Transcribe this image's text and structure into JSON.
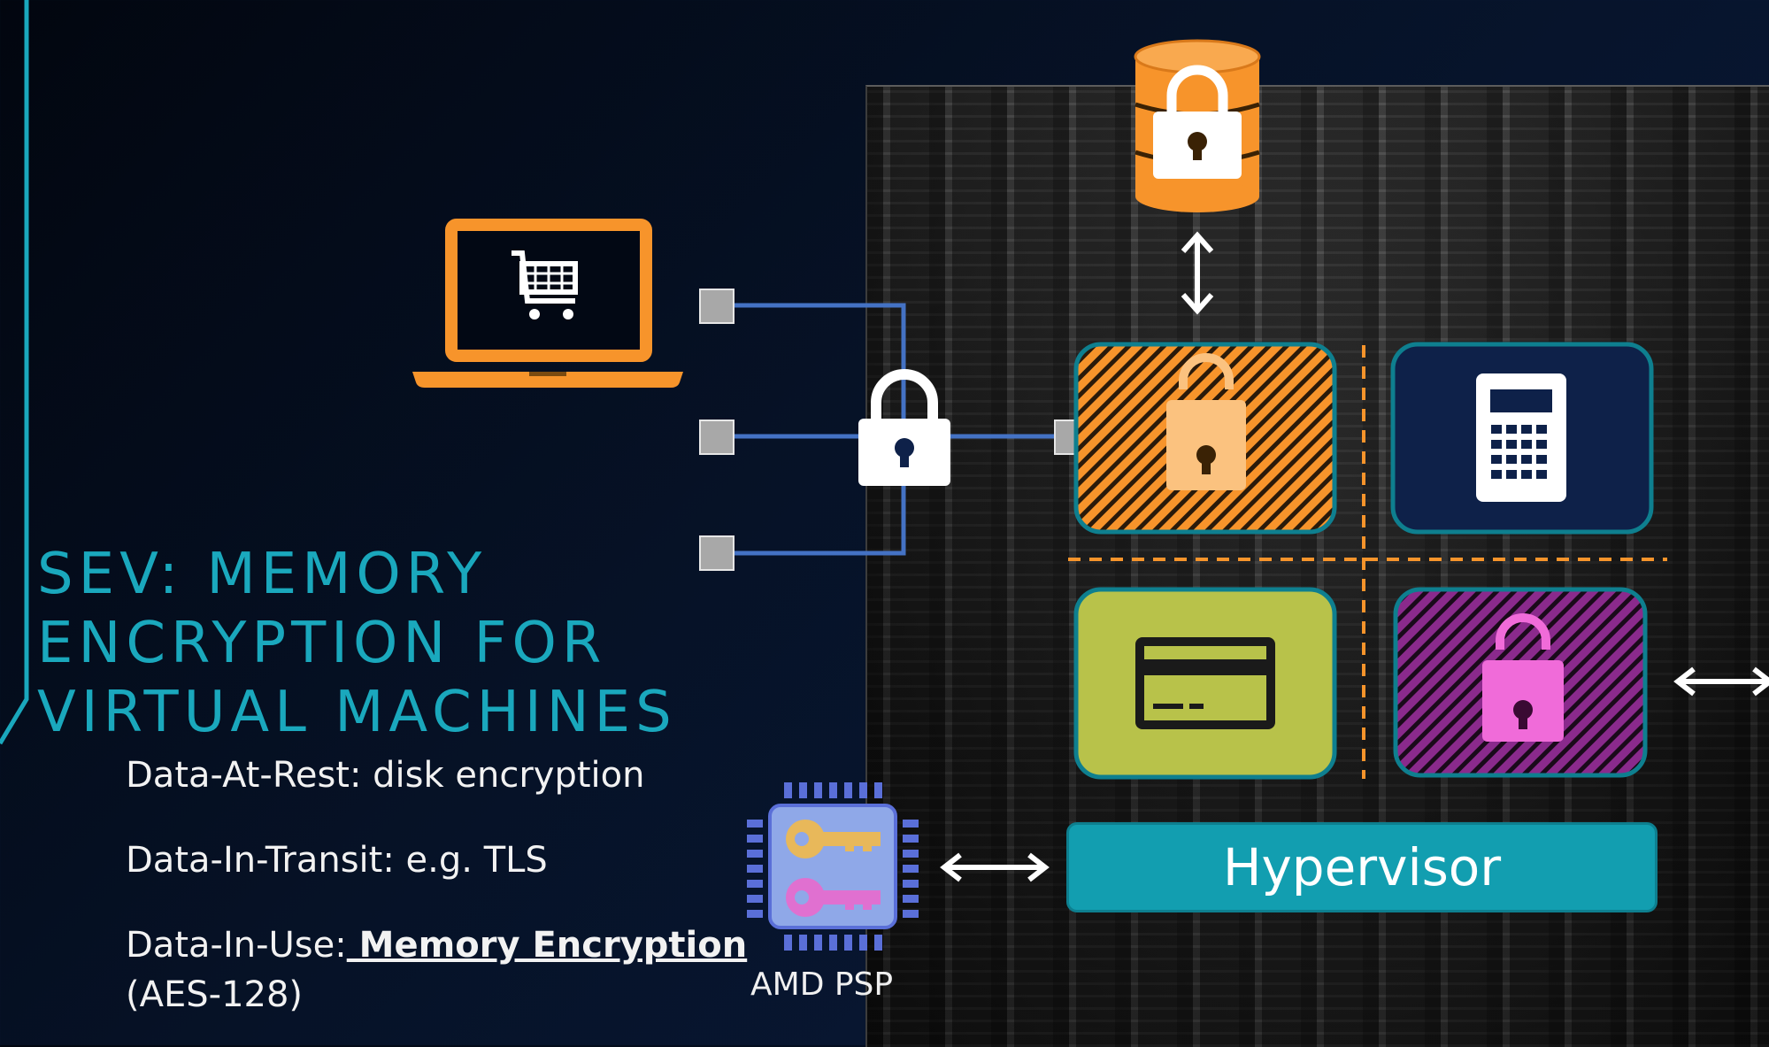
{
  "slide": {
    "title_lines": [
      "SEV: MEMORY",
      "ENCRYPTION FOR",
      "VIRTUAL MACHINES"
    ],
    "bullets": [
      {
        "label": "Data-At-Rest:",
        "text": " disk encryption"
      },
      {
        "label": "Data-In-Transit:",
        "text": " e.g. TLS"
      },
      {
        "label": "Data-In-Use:",
        "emphasis": " Memory Encryption",
        "sub": "(AES-128)"
      }
    ]
  },
  "diagram": {
    "hypervisor_label": "Hypervisor",
    "psp_label": "AMD PSP",
    "icons": [
      "database-lock-icon",
      "laptop-cart-icon",
      "padlock-icon",
      "calculator-icon",
      "credit-card-icon",
      "chip-keys-icon",
      "double-arrow-icon"
    ]
  },
  "colors": {
    "orange": "#f7942b",
    "teal": "#129eb0",
    "title_teal": "#1aa8bd",
    "olive": "#b8c24a",
    "purple": "#8a2a8c",
    "pink": "#f06bd9",
    "navy": "#0e2149",
    "line_blue": "#4472c4"
  }
}
